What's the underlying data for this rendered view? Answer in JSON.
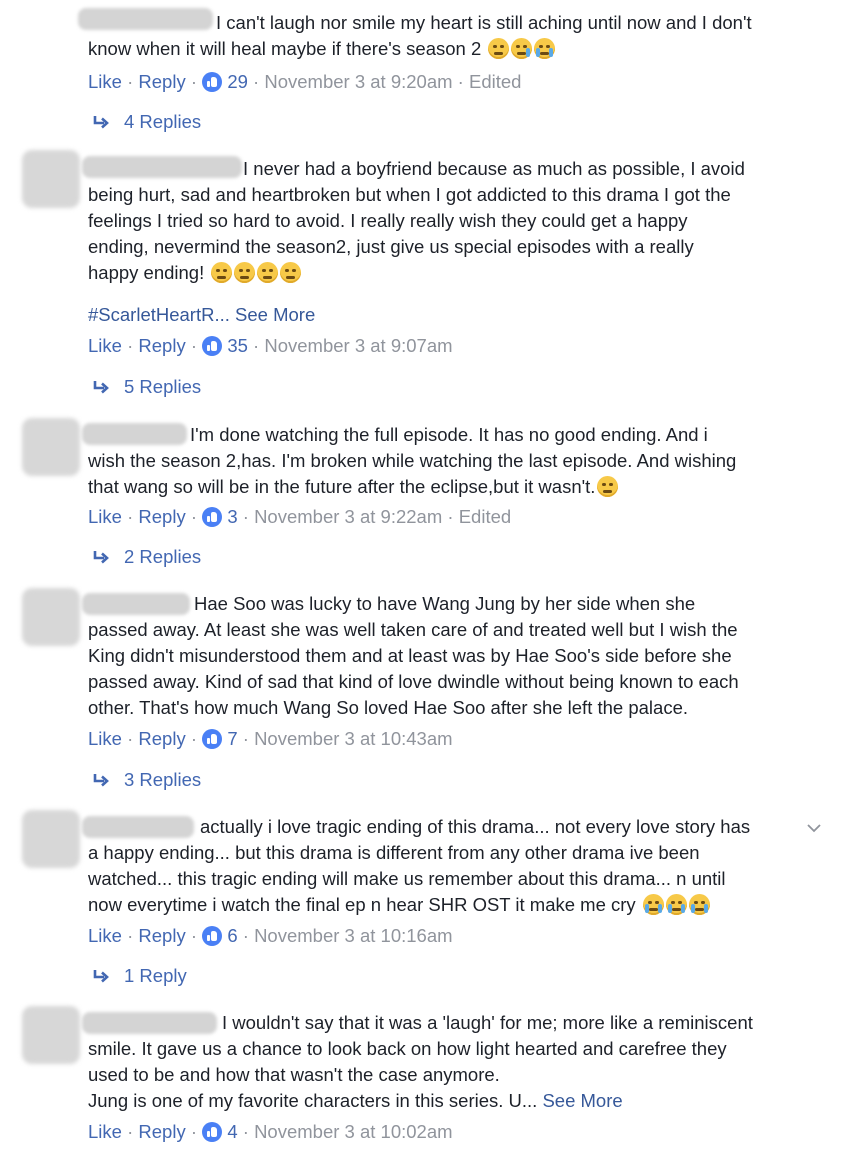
{
  "actions": {
    "like": "Like",
    "reply": "Reply",
    "sep": "·"
  },
  "comments": [
    {
      "lines": [
        "I can't laugh nor smile my heart is still aching until now and I don't",
        "know when it will heal maybe if there's season 2"
      ],
      "emojis": [
        "grinning",
        "sad-tear",
        "crying"
      ],
      "count": "29",
      "time": "November 3 at 9:20am",
      "edited": "Edited",
      "replies": "4 Replies"
    },
    {
      "lines": [
        "I never had a boyfriend because as much as possible, I avoid",
        "being hurt, sad and heartbroken but when I got addicted to this drama I got the",
        "feelings I tried so hard to avoid. I really really wish they could get a happy",
        "ending, nevermind the season2, just give us special episodes with a really",
        "happy ending!"
      ],
      "emojis": [
        "tired",
        "tired",
        "tired",
        "tired"
      ],
      "hashtag": "#ScarletHeartR...",
      "see_more": "See More",
      "count": "35",
      "time": "November 3 at 9:07am",
      "replies": "5 Replies"
    },
    {
      "lines": [
        "I'm done watching the full episode. It has no good ending. And i",
        "wish the season 2,has. I'm broken while watching the last episode. And wishing",
        "that wang so will be in the future after the eclipse,but it wasn't."
      ],
      "emojis": [
        "frowning"
      ],
      "count": "3",
      "time": "November 3 at 9:22am",
      "edited": "Edited",
      "replies": "2 Replies"
    },
    {
      "lines": [
        "Hae Soo was lucky to have Wang Jung by her side when she",
        "passed away. At least she was well taken care of and treated well but I wish the",
        "King didn't misunderstood them and at least was by Hae Soo's side before she",
        "passed away. Kind of sad that kind of love dwindle without being known to each",
        "other. That's how much Wang So loved Hae Soo after she left the palace."
      ],
      "count": "7",
      "time": "November 3 at 10:43am",
      "replies": "3 Replies"
    },
    {
      "lines": [
        "actually i love tragic ending of this drama... not every love story has",
        "a happy ending... but this drama is different from any other drama ive been",
        "watched... this tragic ending will make us remember about this drama... n until",
        "now everytime i watch the final ep n hear SHR OST it make me cry"
      ],
      "emojis": [
        "crying",
        "crying",
        "crying"
      ],
      "count": "6",
      "time": "November 3 at 10:16am",
      "replies": "1 Reply"
    },
    {
      "lines": [
        "I wouldn't say that it was a 'laugh' for me; more like a reminiscent",
        "smile. It gave us a chance to look back on how light hearted and carefree they",
        "used to be and how that wasn't the case anymore.",
        "Jung is one of my favorite characters in this series. U..."
      ],
      "see_more": "See More",
      "count": "4",
      "time": "November 3 at 10:02am"
    }
  ],
  "icons": {
    "like_badge": "thumbs-up-icon",
    "reply_arrow": "reply-arrow-icon",
    "chevron": "chevron-down-icon"
  },
  "colors": {
    "link": "#4267b2",
    "meta": "#90949c",
    "text": "#1d2129",
    "like_badge": "#4a80f5",
    "blur": "#d4d4d4"
  }
}
